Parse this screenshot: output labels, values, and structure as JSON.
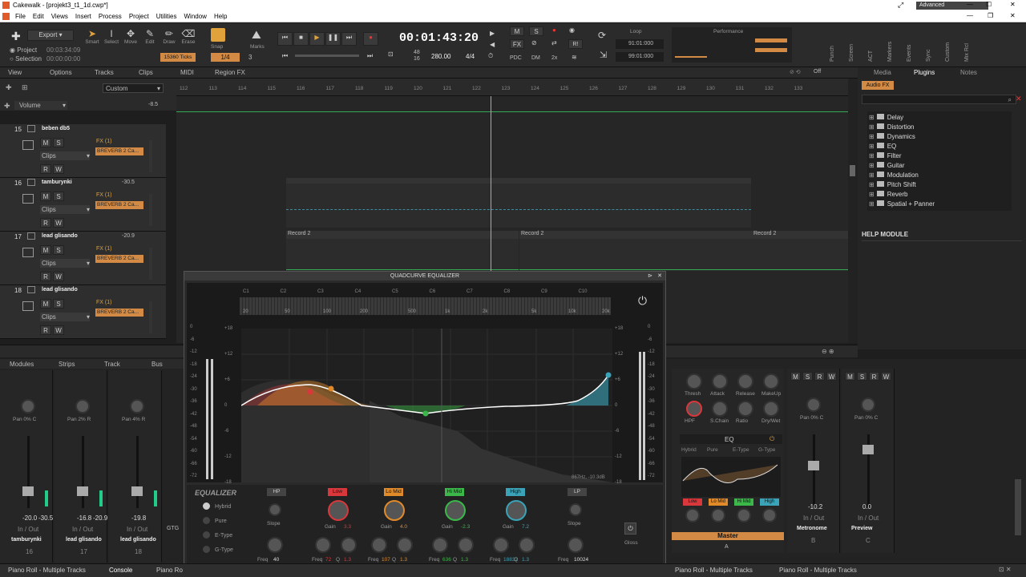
{
  "window": {
    "title": "Cakewalk - [projekt3_t1_1d.cwp*]",
    "workspace": "Advanced"
  },
  "menu": [
    "File",
    "Edit",
    "Views",
    "Insert",
    "Process",
    "Project",
    "Utilities",
    "Window",
    "Help"
  ],
  "toolbar": {
    "export": "Export",
    "project_label": "Project",
    "selection_label": "Selection",
    "project_time": "00:03:34:09",
    "selection_time": "00:00:00:00",
    "tools": [
      "Smart",
      "Select",
      "Move",
      "Edit",
      "Draw",
      "Erase"
    ],
    "snap": "Snap",
    "marks": "Marks",
    "snap_value": "1/4",
    "snap_num": "3",
    "ticks": "15360 Ticks",
    "time": "00:01:43:20",
    "meter_top": "48",
    "meter_bot": "16",
    "tempo": "280.00",
    "sig": "4/4",
    "loop": "Loop",
    "loop_start": "91:01:000",
    "loop_end": "99:01:000",
    "performance": "Performance",
    "side_labels": [
      "Punch",
      "Screen",
      "ACT",
      "Markers",
      "Events",
      "Sync",
      "Custom",
      "Mix Rcl"
    ],
    "mode_buttons": [
      "M",
      "S",
      "FX",
      "PDC",
      "DM",
      "2x"
    ]
  },
  "trackview": {
    "menus": [
      "View",
      "Options",
      "Tracks",
      "Clips",
      "MIDI",
      "Region FX"
    ],
    "custom": "Custom",
    "volume_label": "Volume",
    "volume_val": "-8.5",
    "off_label": "Off",
    "ruler": [
      "112",
      "113",
      "114",
      "115",
      "116",
      "117",
      "118",
      "119",
      "120",
      "121",
      "122",
      "123",
      "124",
      "125",
      "126",
      "127",
      "128",
      "129",
      "130",
      "131",
      "132",
      "133"
    ]
  },
  "tracks": [
    {
      "num": "15",
      "name": "beben db5",
      "vol": "",
      "fx": "FX (1)",
      "plugin": "BREVERB 2 Ca...",
      "clips": "Clips"
    },
    {
      "num": "16",
      "name": "tamburynki",
      "vol": "-30.5",
      "fx": "FX (1)",
      "plugin": "BREVERB 2 Ca...",
      "clips": "Clips"
    },
    {
      "num": "17",
      "name": "lead glisando",
      "vol": "-20.9",
      "fx": "FX (1)",
      "plugin": "BREVERB 2 Ca...",
      "clips": "Clips"
    },
    {
      "num": "18",
      "name": "lead glisando",
      "vol": "",
      "fx": "FX (1)",
      "plugin": "BREVERB 2 Ca...",
      "clips": "Clips"
    }
  ],
  "clips": [
    "Record 2",
    "Record 2",
    "Record 2"
  ],
  "browser": {
    "tabs": [
      "Media",
      "Plugins",
      "Notes"
    ],
    "audio_fx": "Audio FX",
    "folders": [
      "Delay",
      "Distortion",
      "Dynamics",
      "EQ",
      "Filter",
      "Guitar",
      "Modulation",
      "Pitch Shift",
      "Reverb",
      "Spatial + Panner"
    ],
    "help": "HELP MODULE"
  },
  "mixer": {
    "menus": [
      "Modules",
      "Strips",
      "Track",
      "Bus"
    ],
    "strips": [
      {
        "pan": "0% C",
        "vol": "-20.0",
        "peak": "-30.5",
        "io": "In / Out",
        "name": "tamburynki",
        "num": "16"
      },
      {
        "pan": "2% R",
        "vol": "-16.8",
        "peak": "-20.9",
        "io": "In / Out",
        "name": "lead glisando",
        "num": "17"
      },
      {
        "pan": "4% R",
        "vol": "-19.8",
        "peak": "",
        "io": "In / Out",
        "name": "lead glisando",
        "num": "18"
      }
    ],
    "gtg": "GTG",
    "right_strips": [
      {
        "pan": "0% C",
        "vol": "-10.2",
        "io": "In / Out",
        "name": "Metronome",
        "letter": "B"
      },
      {
        "pan": "0% C",
        "vol": "0.0",
        "io": "In / Out",
        "name": "Preview",
        "letter": "C"
      }
    ],
    "master": "Master",
    "master_letter": "A",
    "comp": [
      "Thresh",
      "Attack",
      "Release",
      "MakeUp",
      "HPF",
      "S.Chain",
      "Ratio",
      "Dry/Wet"
    ],
    "eq_label": "EQ",
    "eq_modes": [
      "Hybrid",
      "Pure",
      "E-Type",
      "G-Type"
    ],
    "bands": [
      "Low",
      "Lo Mid",
      "Hi Mid",
      "High"
    ]
  },
  "eq": {
    "title": "QUADCURVE EQUALIZER",
    "notes": [
      "C1",
      "C2",
      "C3",
      "C4",
      "C5",
      "C6",
      "C7",
      "C8",
      "C9",
      "C10"
    ],
    "freqs": [
      "20",
      "50",
      "100",
      "200",
      "500",
      "1k",
      "2k",
      "5k",
      "10k",
      "20k"
    ],
    "db_left": [
      "+18",
      "+12",
      "+6",
      "0",
      "-6",
      "-12",
      "-18"
    ],
    "meter_scale": [
      "0",
      "-6",
      "-12",
      "-18",
      "-24",
      "-30",
      "-36",
      "-42",
      "-48",
      "-54",
      "-60",
      "-66",
      "-72"
    ],
    "readout": "867Hz, -10.3dB",
    "label": "EQUALIZER",
    "modes": [
      "Hybrid",
      "Pure",
      "E-Type",
      "G-Type"
    ],
    "hp": {
      "label": "HP",
      "slope": "Slope",
      "freq": "Freq",
      "freq_val": "40"
    },
    "low": {
      "label": "Low",
      "gain": "Gain",
      "gain_val": "3.3",
      "freq_val": "72",
      "q_val": "1.3"
    },
    "lomid": {
      "label": "Lo Mid",
      "gain": "Gain",
      "gain_val": "4.0",
      "freq_val": "107",
      "q_val": "1.3"
    },
    "himid": {
      "label": "Hi Mid",
      "gain": "Gain",
      "gain_val": "-2.3",
      "freq_val": "636",
      "q_val": "1.3"
    },
    "high": {
      "label": "High",
      "gain": "Gain",
      "gain_val": "7.2",
      "freq_val": "18832",
      "q_val": "1.3"
    },
    "lp": {
      "label": "LP",
      "slope": "Slope",
      "freq": "Freq",
      "freq_val": "10024"
    },
    "gloss": "Gloss",
    "q": "Q",
    "freq": "Freq"
  },
  "status": [
    "Piano Roll - Multiple Tracks",
    "Console",
    "Piano Ro",
    "Piano Roll - Multiple Tracks",
    "Piano Roll - Multiple Tracks"
  ],
  "colors": {
    "low": "#d8383b",
    "lomid": "#e08a2a",
    "himid": "#3cb84a",
    "high": "#3aa3b8",
    "fx": "#d28a44"
  }
}
